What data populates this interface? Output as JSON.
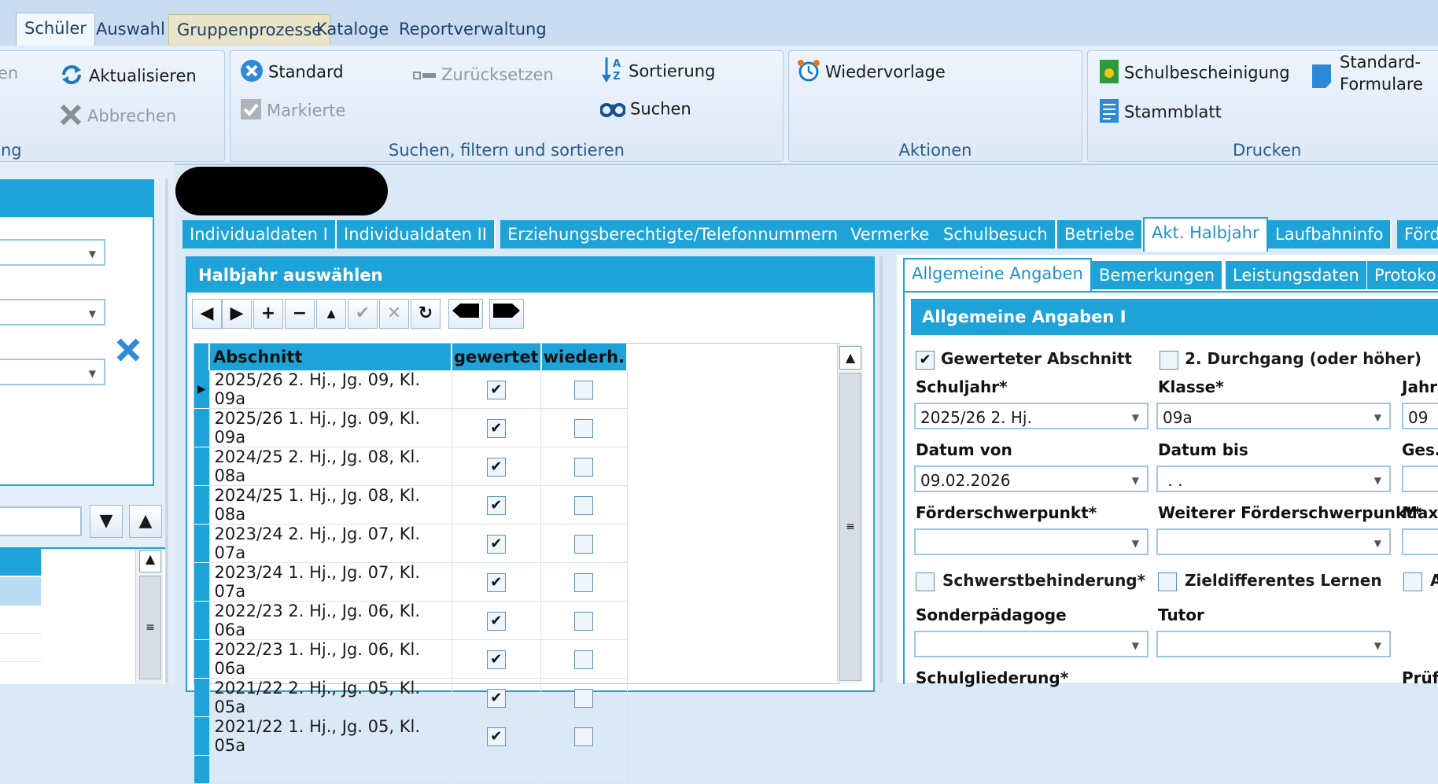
{
  "ribbon_tabs": [
    "Schüler",
    "Auswahl",
    "Gruppenprozesse",
    "Kataloge",
    "Reportverwaltung"
  ],
  "ribbon": {
    "cut_label": "en",
    "cut_group": "ng",
    "refresh": "Aktualisieren",
    "cancel": "Abbrechen",
    "standard": "Standard",
    "marked": "Markierte",
    "reset": "Zurücksetzen",
    "sort": "Sortierung",
    "search": "Suchen",
    "search_group": "Suchen, filtern und sortieren",
    "resubmit": "Wiedervorlage",
    "actions_group": "Aktionen",
    "school_cert": "Schulbescheinigung",
    "master_sheet": "Stammblatt",
    "std_forms_1": "Standard-",
    "std_forms_2": "Formulare",
    "print_group": "Drucken"
  },
  "detail_tabs": [
    "Individualdaten I",
    "Individualdaten II",
    "Erziehungsberechtigte/Telefonnummern",
    "Vermerke",
    "Schulbesuch",
    "Betriebe",
    "Akt. Halbjahr",
    "Laufbahninfo",
    "Förd"
  ],
  "halfyear": {
    "title": "Halbjahr auswählen",
    "columns": [
      "Abschnitt",
      "gewertet",
      "wiederh."
    ],
    "rows": [
      {
        "label": "2025/26 2. Hj., Jg. 09, Kl. 09a",
        "gewertet": true,
        "wiederh": false
      },
      {
        "label": "2025/26 1. Hj., Jg. 09, Kl. 09a",
        "gewertet": true,
        "wiederh": false
      },
      {
        "label": "2024/25 2. Hj., Jg. 08, Kl. 08a",
        "gewertet": true,
        "wiederh": false
      },
      {
        "label": "2024/25 1. Hj., Jg. 08, Kl. 08a",
        "gewertet": true,
        "wiederh": false
      },
      {
        "label": "2023/24 2. Hj., Jg. 07, Kl. 07a",
        "gewertet": true,
        "wiederh": false
      },
      {
        "label": "2023/24 1. Hj., Jg. 07, Kl. 07a",
        "gewertet": true,
        "wiederh": false
      },
      {
        "label": "2022/23 2. Hj., Jg. 06, Kl. 06a",
        "gewertet": true,
        "wiederh": false
      },
      {
        "label": "2022/23 1. Hj., Jg. 06, Kl. 06a",
        "gewertet": true,
        "wiederh": false
      },
      {
        "label": "2021/22 2. Hj., Jg. 05, Kl. 05a",
        "gewertet": true,
        "wiederh": false
      },
      {
        "label": "2021/22 1. Hj., Jg. 05, Kl. 05a",
        "gewertet": true,
        "wiederh": false
      }
    ]
  },
  "sub_tabs": [
    "Allgemeine Angaben",
    "Bemerkungen",
    "Leistungsdaten",
    "Protoko"
  ],
  "general": {
    "title": "Allgemeine Angaben I",
    "chk_gewertet": "Gewerteter Abschnitt",
    "chk_durchgang": "2. Durchgang (oder höher)",
    "schuljahr_label": "Schuljahr*",
    "schuljahr_value": "2025/26 2. Hj.",
    "klasse_label": "Klasse*",
    "klasse_value": "09a",
    "jahr_label": "Jahrg",
    "jahr_value": "09",
    "datum_von_label": "Datum von",
    "datum_von_value": "09.02.2026",
    "datum_bis_label": "Datum bis",
    "datum_bis_value": " . .",
    "ges_label": "Ges.",
    "foerder_label": "Förderschwerpunkt*",
    "weiterer_label": "Weiterer Förderschwerpunkt*",
    "max_label": "Max",
    "chk_schwerst": "Schwerstbehinderung*",
    "chk_ziel": "Zieldifferentes Lernen",
    "chk_a": "A",
    "sonder_label": "Sonderpädagoge",
    "tutor_label": "Tutor",
    "schulgl_label": "Schulgliederung*",
    "pruef_label": "Prüf"
  },
  "colors": {
    "accent": "#1da3d8",
    "ribbon": "#e4eef9"
  }
}
